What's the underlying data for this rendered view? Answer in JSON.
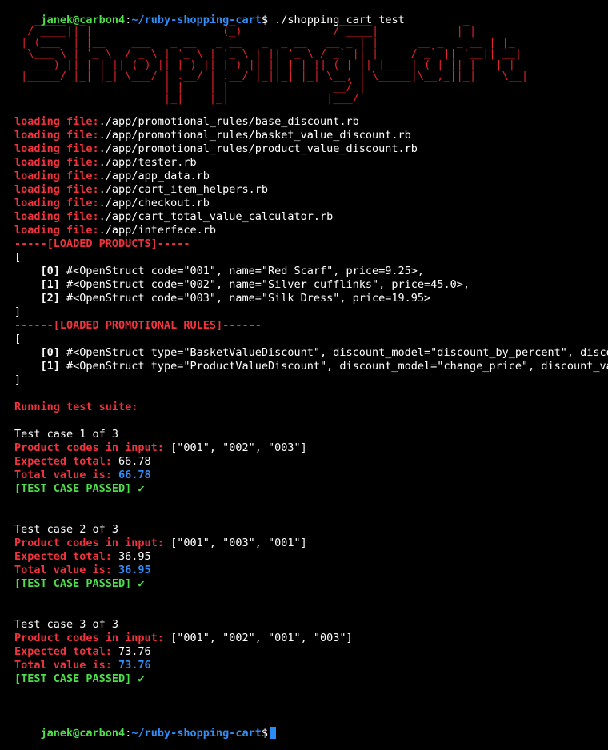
{
  "prompt": {
    "user_host": "janek@carbon4",
    "sep": ":",
    "path": "~/ruby-shopping-cart",
    "dollar": "$",
    "command": " ./shopping_cart test"
  },
  "ascii_art": [
    "   _____  _                      _                _____              _   ",
    "  / ____|| |                    (_)              / ____|            | |  ",
    " | (___  | |__    ___   _ __   _ __   _  _ __   __ _ | |      __ _  _ __ | |_ ",
    "  \\___ \\ | '_ \\  / _ \\ | '_ \\ | '_ \\ | || '_ \\ / _` || |     / _` || '__|| __|",
    "  ____) || | | || (_) || |_) || |_) || || | | || (_| || |____| (_| || |   | |_ ",
    " |_____/ |_| |_| \\___/ | .__/ | .__/ |_||_| |_| \\__, | \\_____|\\__,_||_|    \\__|",
    "                       | |    | |                __/ |                        ",
    "                       |_|    |_|               |___/                         "
  ],
  "loading": {
    "prefix": "loading file:",
    "files": [
      "./app/promotional_rules/base_discount.rb",
      "./app/promotional_rules/basket_value_discount.rb",
      "./app/promotional_rules/product_value_discount.rb",
      "./app/tester.rb",
      "./app/app_data.rb",
      "./app/cart_item_helpers.rb",
      "./app/checkout.rb",
      "./app/cart_total_value_calculator.rb",
      "./app/interface.rb"
    ]
  },
  "products": {
    "header": "-----[LOADED PRODUCTS]-----",
    "open": "[",
    "close": "]",
    "items": [
      {
        "index": "[0]",
        "text": " #<OpenStruct code=\"001\", name=\"Red Scarf\", price=9.25>,"
      },
      {
        "index": "[1]",
        "text": " #<OpenStruct code=\"002\", name=\"Silver cufflinks\", price=45.0>,"
      },
      {
        "index": "[2]",
        "text": " #<OpenStruct code=\"003\", name=\"Silk Dress\", price=19.95>"
      }
    ]
  },
  "rules": {
    "header": "------[LOADED PROMOTIONAL RULES]------",
    "open": "[",
    "close": "]",
    "items": [
      {
        "index": "[0]",
        "text": " #<OpenStruct type=\"BasketValueDiscount\", discount_model=\"discount_by_percent\", discou"
      },
      {
        "index": "[1]",
        "text": " #<OpenStruct type=\"ProductValueDiscount\", discount_model=\"change_price\", discount_val"
      }
    ]
  },
  "suite": {
    "title": "Running test suite:",
    "cases": [
      {
        "title": "Test case 1 of 3",
        "codes_label": "Product codes in input:",
        "codes": " [\"001\", \"002\", \"003\"]",
        "expected_label": "Expected total:",
        "expected": " 66.78",
        "total_label": "Total value is:",
        "total": " 66.78",
        "passed": "[TEST CASE PASSED] ✔"
      },
      {
        "title": "Test case 2 of 3",
        "codes_label": "Product codes in input:",
        "codes": " [\"001\", \"003\", \"001\"]",
        "expected_label": "Expected total:",
        "expected": " 36.95",
        "total_label": "Total value is:",
        "total": " 36.95",
        "passed": "[TEST CASE PASSED] ✔"
      },
      {
        "title": "Test case 3 of 3",
        "codes_label": "Product codes in input:",
        "codes": " [\"001\", \"002\", \"001\", \"003\"]",
        "expected_label": "Expected total:",
        "expected": " 73.76",
        "total_label": "Total value is:",
        "total": " 73.76",
        "passed": "[TEST CASE PASSED] ✔"
      }
    ]
  },
  "colors": {
    "background": "#000000",
    "prompt_green": "#4ddf4a",
    "prompt_blue": "#2f8df5",
    "label_red": "#f0333d",
    "cursor": "#2a8bf2"
  }
}
